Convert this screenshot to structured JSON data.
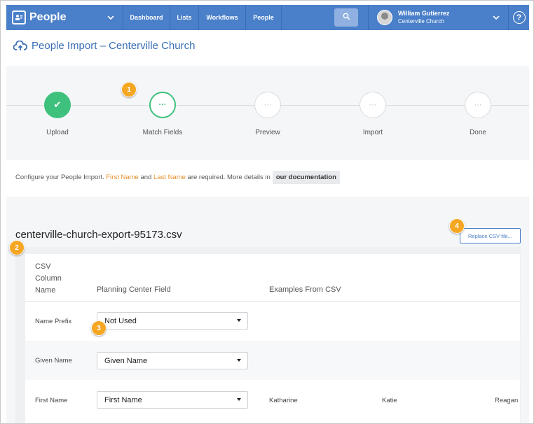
{
  "nav": {
    "brand": "People",
    "items": [
      "Dashboard",
      "Lists",
      "Workflows",
      "People"
    ],
    "user_name": "William Gutierrez",
    "user_org": "Centerville Church",
    "help": "?"
  },
  "page": {
    "title": "People Import – Centerville Church"
  },
  "steps": [
    {
      "label": "Upload",
      "state": "done",
      "glyph": "✔"
    },
    {
      "label": "Match Fields",
      "state": "active",
      "glyph": "···"
    },
    {
      "label": "Preview",
      "state": "pending",
      "glyph": "···"
    },
    {
      "label": "Import",
      "state": "pending",
      "glyph": "···"
    },
    {
      "label": "Done",
      "state": "pending",
      "glyph": "···"
    }
  ],
  "info": {
    "prefix": "Configure your People Import.",
    "first": "First Name",
    "and": "and",
    "last": "Last Name",
    "suffix": "are required. More details in",
    "link": "our documentation"
  },
  "file": {
    "name": "centerville-church-export-95173.csv",
    "replace_label": "Replace CSV file..."
  },
  "table": {
    "col_csv": "CSV Column Name",
    "col_field": "Planning Center Field",
    "col_examples": "Examples From CSV",
    "rows": [
      {
        "label": "Name Prefix",
        "value": "Not Used",
        "examples": []
      },
      {
        "label": "Given Name",
        "value": "Given Name",
        "examples": []
      },
      {
        "label": "First Name",
        "value": "First Name",
        "examples": [
          "Katharine",
          "Katie",
          "Reagan"
        ]
      }
    ]
  },
  "badges": [
    "1",
    "2",
    "3",
    "4"
  ],
  "colors": {
    "nav": "#4a7fc9",
    "accent_green": "#3ec17c",
    "required": "#e8902b",
    "badge": "#f5a623"
  }
}
